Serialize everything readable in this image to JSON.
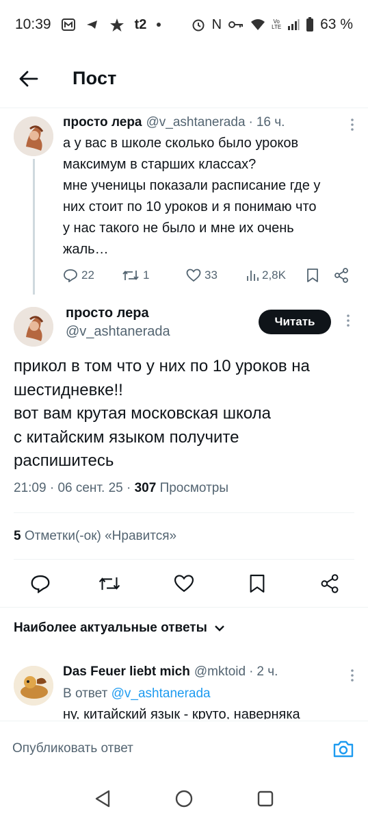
{
  "status_bar": {
    "time": "10:39",
    "battery": "63 %",
    "icons": [
      "mts-app-icon",
      "telegram-icon",
      "vk-icon",
      "t2-icon",
      "dot-icon",
      "alarm-icon",
      "nfc-icon",
      "key-icon",
      "wifi-icon",
      "volte-icon",
      "signal-icon",
      "battery-icon"
    ],
    "t2_label": "t2",
    "volte_label": "Vo LTE",
    "nfc_label": "N"
  },
  "header": {
    "title": "Пост",
    "back_icon": "arrow-left-icon"
  },
  "parent_tweet": {
    "name": "просто лера",
    "handle": "@v_ashtanerada",
    "time": "16 ч.",
    "text": "а у вас в школе сколько было уроков\nмаксимум в старших классах?\nмне ученицы показали расписание где у\nних стоит по 10 уроков и я понимаю что\nу нас такого не было и мне их очень\nжаль…",
    "replies": "22",
    "retweets": "1",
    "likes": "33",
    "views": "2,8K"
  },
  "main_tweet": {
    "name": "просто лера",
    "handle": "@v_ashtanerada",
    "follow_label": "Читать",
    "text": "прикол в том что у них по 10 уроков на\nшестидневке!!\nвот вам крутая московская школа\nс китайским языком получите\nраспишитесь",
    "time": "21:09",
    "date": "06 сент. 25",
    "views_count": "307",
    "views_label": "Просмотры",
    "likes_count": "5",
    "likes_label": "Отметки(-ок) «Нравится»"
  },
  "sort": {
    "label": "Наиболее актуальные ответы"
  },
  "reply": {
    "name": "Das Feuer liebt mich",
    "handle": "@mktoid",
    "time": "2 ч.",
    "reply_prefix": "В ответ",
    "reply_to": "@v_ashtanerada",
    "text": "ну, китайский язык - круто, наверняка"
  },
  "compose": {
    "placeholder": "Опубликовать ответ"
  },
  "colors": {
    "accent": "#1d9bf0",
    "text": "#0f1419",
    "secondary": "#536471",
    "divider": "#eff3f4"
  }
}
